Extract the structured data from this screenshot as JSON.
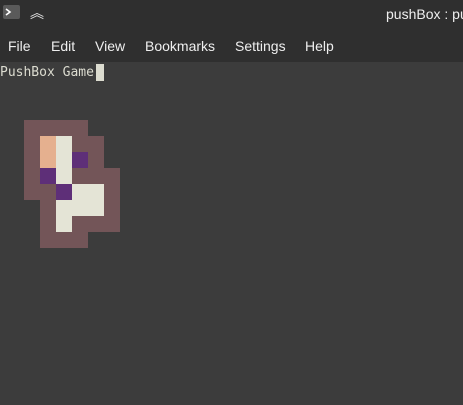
{
  "window": {
    "title": "pushBox : pu"
  },
  "menu": [
    {
      "label": "File"
    },
    {
      "label": "Edit"
    },
    {
      "label": "View"
    },
    {
      "label": "Bookmarks"
    },
    {
      "label": "Settings"
    },
    {
      "label": "Help"
    }
  ],
  "terminal": {
    "line": "PushBox Game"
  },
  "game": {
    "legend": {
      "W": "wall",
      "F": "floor",
      "P": "player",
      "B": "box"
    },
    "colors": {
      "wall": "#735558",
      "floor": "#e4e4d6",
      "player": "#e5b08f",
      "box": "#5e2f78",
      "background": "#3c3c3c",
      "chrome": "#2f2f2f"
    },
    "rows": [
      "WWWW....",
      "WPFWW...",
      "WPFBW...",
      "WBFWWW..",
      "WWBFFW..",
      ".WFFFW..",
      ".WFWWW..",
      ".WWW...."
    ]
  }
}
